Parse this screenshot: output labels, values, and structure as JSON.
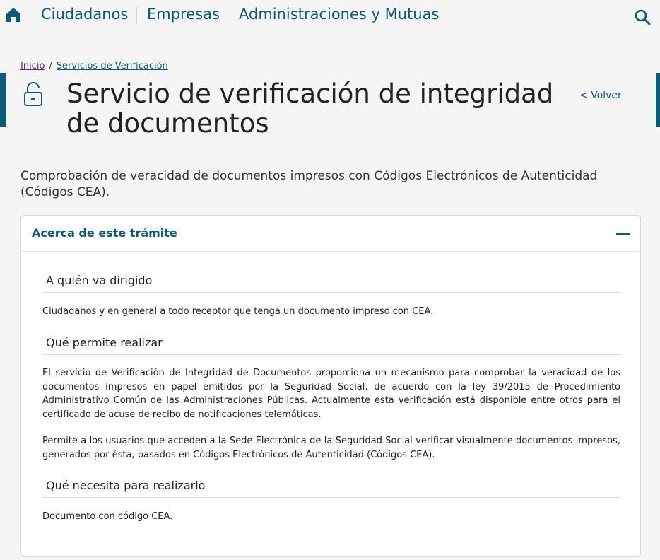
{
  "nav": {
    "home_icon": "home-icon",
    "links": [
      "Ciudadanos",
      "Empresas",
      "Administraciones y Mutuas"
    ],
    "search_icon": "search-icon",
    "accent": "#0a5a78"
  },
  "breadcrumb": {
    "home": "Inicio",
    "separator": "/",
    "current": "Servicios de Verificación"
  },
  "title": {
    "icon": "unlocked-padlock-icon",
    "text": "Servicio de verificación de integridad de documentos",
    "back": "< Volver"
  },
  "intro": "Comprobación de veracidad de documentos impresos con Códigos Electrónicos de Autenticidad (Códigos CEA).",
  "card": {
    "title": "Acerca de este trámite",
    "collapse_icon": "minus-icon",
    "sections": [
      {
        "heading": "A quién va dirigido",
        "paragraphs": [
          "Ciudadanos y en general a todo receptor que tenga un documento impreso con CEA."
        ]
      },
      {
        "heading": "Qué permite realizar",
        "paragraphs": [
          "El servicio de Verificación de Integridad de Documentos proporciona un mecanismo para comprobar la veracidad de los documentos impresos en papel emitidos por la Seguridad Social, de acuerdo con la ley 39/2015 de Procedimiento Administrativo Común de las Administraciones Públicas. Actualmente esta verificación está disponible entre otros para el certificado de acuse de recibo de notificaciones telemáticas.",
          "Permite a los usuarios que acceden a la Sede Electrónica de la Seguridad Social verificar visualmente documentos impresos, generados por ésta, basados en Códigos Electrónicos de Autenticidad (Códigos CEA)."
        ]
      },
      {
        "heading": "Qué necesita para realizarlo",
        "paragraphs": [
          "Documento con código CEA."
        ]
      }
    ]
  }
}
